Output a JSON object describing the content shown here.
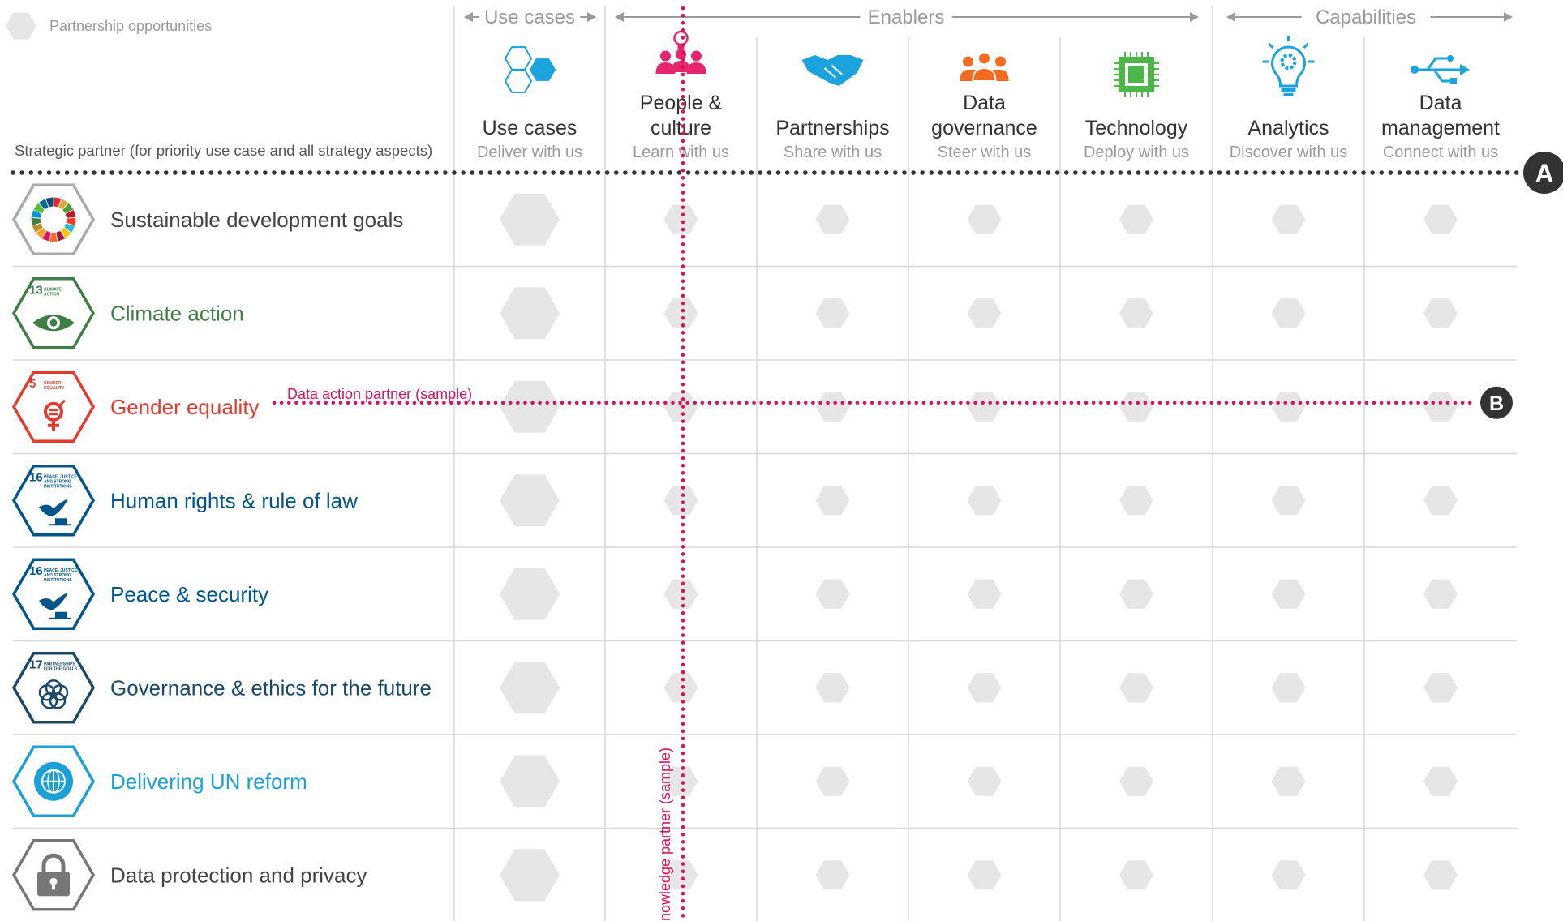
{
  "legend": {
    "label": "Partnership opportunities"
  },
  "header": {
    "groups": [
      {
        "label": "Use cases"
      },
      {
        "label": "Enablers"
      },
      {
        "label": "Capabilities"
      }
    ],
    "strategic_partner_label": "Strategic partner (for priority use case and all strategy aspects)"
  },
  "columns": [
    {
      "title": [
        "Use cases"
      ],
      "subtitle": "Deliver with us",
      "icon": "hexagons-icon",
      "color": "#1aa3dc"
    },
    {
      "title": [
        "People &",
        "culture"
      ],
      "subtitle": "Learn with us",
      "icon": "people-idea-icon",
      "color": "#e5266e"
    },
    {
      "title": [
        "Partnerships"
      ],
      "subtitle": "Share with us",
      "icon": "handshake-icon",
      "color": "#1aa3dc"
    },
    {
      "title": [
        "Data",
        "governance"
      ],
      "subtitle": "Steer with us",
      "icon": "group-icon",
      "color": "#f26b21"
    },
    {
      "title": [
        "Technology"
      ],
      "subtitle": "Deploy with us",
      "icon": "chip-icon",
      "color": "#4cb748"
    },
    {
      "title": [
        "Analytics"
      ],
      "subtitle": "Discover with us",
      "icon": "lightbulb-gear-icon",
      "color": "#1aa3dc"
    },
    {
      "title": [
        "Data",
        "management"
      ],
      "subtitle": "Connect with us",
      "icon": "usb-icon",
      "color": "#1aa3dc"
    }
  ],
  "rows": [
    {
      "label": "Sustainable development goals",
      "color": "#444444",
      "badge": "sdg-wheel-icon",
      "badge_color": "#aaaaaa"
    },
    {
      "label": "Climate action",
      "color": "#3f7e44",
      "badge": "eye-globe-icon",
      "badge_color": "#3f7e44",
      "goal": "13",
      "goal_text": [
        "CLIMATE",
        "ACTION"
      ]
    },
    {
      "label": "Gender equality",
      "color": "#e5392d",
      "badge": "gender-icon",
      "badge_color": "#e5392d",
      "goal": "5",
      "goal_text": [
        "GENDER",
        "EQUALITY"
      ]
    },
    {
      "label": "Human rights & rule of law",
      "color": "#01558b",
      "badge": "dove-gavel-icon",
      "badge_color": "#01558b",
      "goal": "16",
      "goal_text": [
        "PEACE, JUSTICE",
        "AND STRONG",
        "INSTITUTIONS"
      ]
    },
    {
      "label": "Peace & security",
      "color": "#01558b",
      "badge": "dove-gavel-icon",
      "badge_color": "#01558b",
      "goal": "16",
      "goal_text": [
        "PEACE, JUSTICE",
        "AND STRONG",
        "INSTITUTIONS"
      ]
    },
    {
      "label": "Governance & ethics for the future",
      "color": "#19486a",
      "badge": "rings-icon",
      "badge_color": "#19486a",
      "goal": "17",
      "goal_text": [
        "PARTNERSHIPS",
        "FOR THE GOALS"
      ]
    },
    {
      "label": "Delivering UN reform",
      "color": "#1ba0d8",
      "badge": "un-emblem-icon",
      "badge_color": "#1ba0d8"
    },
    {
      "label": "Data protection and privacy",
      "color": "#444444",
      "badge": "padlock-icon",
      "badge_color": "#777777"
    }
  ],
  "annotations": {
    "A": {
      "letter": "A"
    },
    "B": {
      "letter": "B",
      "label": "Data action partner (sample)",
      "color": "#d6135d"
    },
    "knowledge": {
      "label": "Knowledge partner (sample)",
      "color": "#d6135d"
    }
  },
  "colors": {
    "grid": "#d7d7d7",
    "hex_fill": "#e6e6e6",
    "header_grey": "#9a9a9a",
    "title": "#333333",
    "subtitle": "#9a9a9a"
  }
}
